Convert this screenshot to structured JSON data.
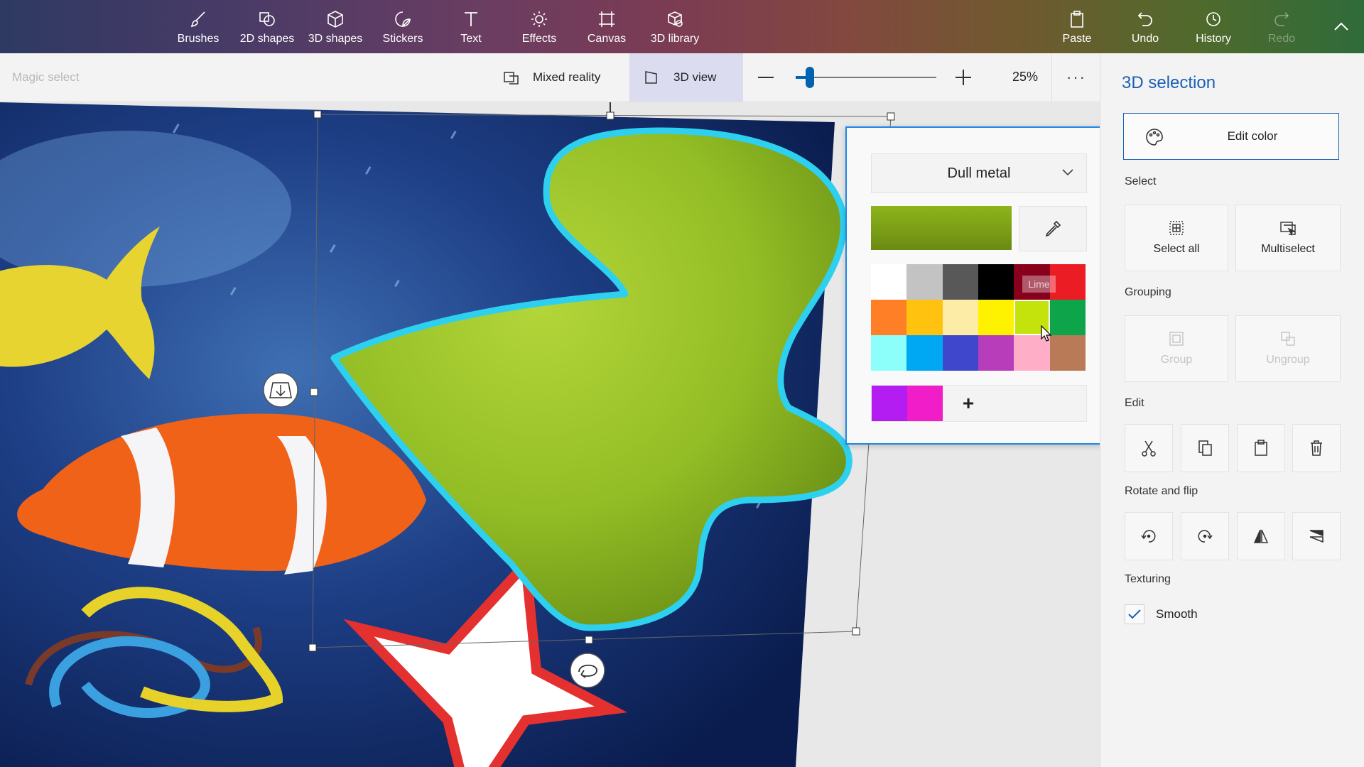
{
  "toolbar": {
    "tools": [
      {
        "label": "Brushes",
        "icon": "brush-icon"
      },
      {
        "label": "2D shapes",
        "icon": "2d-shapes-icon"
      },
      {
        "label": "3D shapes",
        "icon": "3d-shapes-icon"
      },
      {
        "label": "Stickers",
        "icon": "sticker-icon"
      },
      {
        "label": "Text",
        "icon": "text-icon"
      },
      {
        "label": "Effects",
        "icon": "effects-icon"
      },
      {
        "label": "Canvas",
        "icon": "canvas-icon"
      },
      {
        "label": "3D library",
        "icon": "3d-library-icon"
      }
    ],
    "actions": [
      {
        "label": "Paste",
        "icon": "paste-icon"
      },
      {
        "label": "Undo",
        "icon": "undo-icon"
      },
      {
        "label": "History",
        "icon": "history-icon"
      },
      {
        "label": "Redo",
        "icon": "redo-icon",
        "disabled": true
      }
    ],
    "collapse_icon": "chevron-up-icon"
  },
  "subbar": {
    "magic_select": "Magic select",
    "mixed_reality": "Mixed reality",
    "view_3d": "3D view",
    "zoom_percent": "25%",
    "zoom_level": 0.1,
    "more_icon": "more-icon"
  },
  "panel": {
    "title": "3D selection",
    "edit_color": "Edit color",
    "select_heading": "Select",
    "select_all": "Select all",
    "multiselect": "Multiselect",
    "grouping_heading": "Grouping",
    "group": "Group",
    "ungroup": "Ungroup",
    "edit_heading": "Edit",
    "edit_icons": [
      "cut-icon",
      "copy-icon",
      "paste-icon",
      "delete-icon"
    ],
    "rotate_heading": "Rotate and flip",
    "rotate_icons": [
      "rotate-left-icon",
      "rotate-right-icon",
      "flip-horizontal-icon",
      "flip-vertical-icon"
    ],
    "texturing_heading": "Texturing",
    "smooth_label": "Smooth",
    "smooth_checked": true
  },
  "color_popup": {
    "material": "Dull metal",
    "selected_color": "#8db51b",
    "tooltip": "Lime",
    "palette": [
      [
        "#ffffff",
        "#c3c3c3",
        "#585858",
        "#000000",
        "#88001b",
        "#ec1c24"
      ],
      [
        "#ff7f27",
        "#ffc20e",
        "#fdeca6",
        "#fff200",
        "#c4e20c",
        "#0ea54a"
      ],
      [
        "#8cfffb",
        "#00a8f3",
        "#3f48cc",
        "#b83dba",
        "#ffaec8",
        "#b97a57"
      ]
    ],
    "custom_colors": [
      "#b31df2",
      "#f01dc8"
    ],
    "add_label": "+"
  }
}
